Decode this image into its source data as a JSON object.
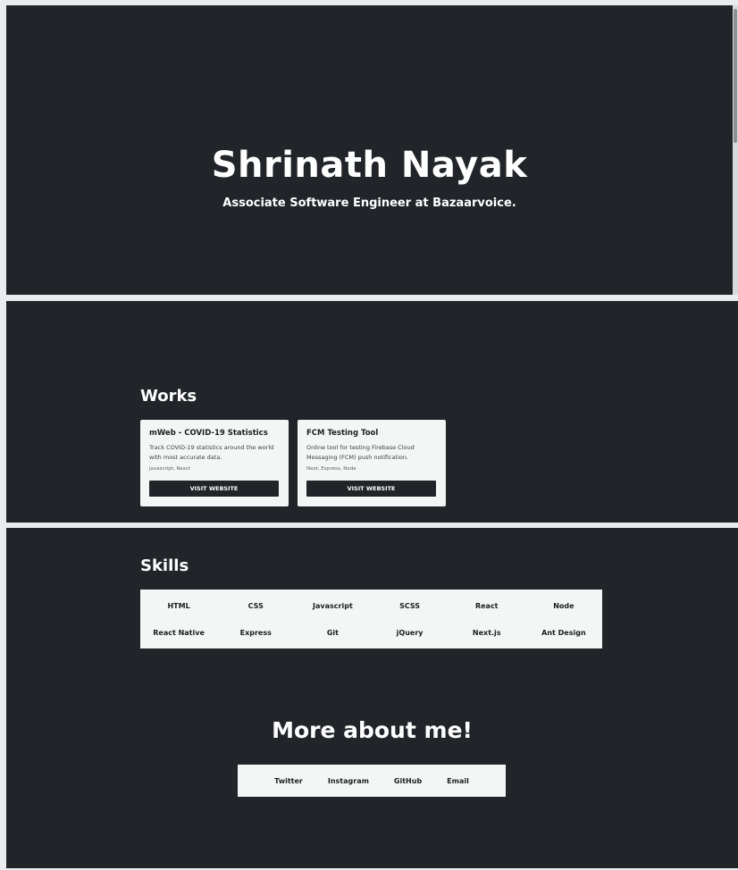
{
  "hero": {
    "name": "Shrinath Nayak",
    "subtitle": "Associate Software Engineer at Bazaarvoice."
  },
  "works": {
    "heading": "Works",
    "cards": [
      {
        "title": "mWeb - COVID-19 Statistics",
        "description": "Track COVID-19 statistics around the world with most accurate data.",
        "tech": "Javascript, React",
        "button_label": "VISIT WEBSITE"
      },
      {
        "title": "FCM Testing Tool",
        "description": "Online tool for testing Firebase Cloud Messaging (FCM) push notification.",
        "tech": "Next, Express, Node",
        "button_label": "VISIT WEBSITE"
      }
    ]
  },
  "skills": {
    "heading": "Skills",
    "items": [
      "HTML",
      "CSS",
      "Javascript",
      "SCSS",
      "React",
      "Node",
      "React Native",
      "Express",
      "Git",
      "jQuery",
      "Next.js",
      "Ant Design"
    ]
  },
  "more": {
    "heading": "More about me!",
    "links": [
      "Twitter",
      "Instagram",
      "GitHub",
      "Email"
    ]
  },
  "colors": {
    "section_bg": "#212529",
    "card_bg": "#f4f5f5",
    "page_bg": "#e9ebec"
  }
}
